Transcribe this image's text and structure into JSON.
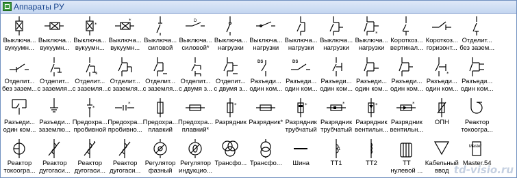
{
  "window": {
    "title": "Аппараты РУ",
    "watermark": "td-visio.ru"
  },
  "stencils": [
    {
      "name": "switch-vacuum",
      "l1": "Выключа...",
      "l2": "вукуумн...",
      "icon": "box-x"
    },
    {
      "name": "switch-vacuum-2",
      "l1": "Выключа...",
      "l2": "вукуумн...",
      "icon": "box-x-h"
    },
    {
      "name": "switch-vacuum-3",
      "l1": "Выключа...",
      "l2": "вукуумн...",
      "icon": "box-x-star"
    },
    {
      "name": "switch-vacuum-4",
      "l1": "Выключа...",
      "l2": "вукуумн...",
      "icon": "box-x-h-star"
    },
    {
      "name": "switch-power",
      "l1": "Выключа...",
      "l2": "силовой",
      "icon": "sw-v"
    },
    {
      "name": "switch-power-2",
      "l1": "Выключа...",
      "l2": "силовой*",
      "icon": "sw-h"
    },
    {
      "name": "switch-load",
      "l1": "Выключа...",
      "l2": "нагрузки",
      "icon": "sw-v2"
    },
    {
      "name": "switch-load-2",
      "l1": "Выключа...",
      "l2": "нагрузки",
      "icon": "sw-h2"
    },
    {
      "name": "switch-load-3",
      "l1": "Выключа...",
      "l2": "нагрузки",
      "icon": "sw-bracket"
    },
    {
      "name": "switch-load-4",
      "l1": "Выключа...",
      "l2": "нагрузки",
      "icon": "sw-bracket2"
    },
    {
      "name": "switch-load-5",
      "l1": "Выключа...",
      "l2": "нагрузки",
      "icon": "sw-bracket3"
    },
    {
      "name": "shorter-vertical",
      "l1": "Короткоз...",
      "l2": "вертикал...",
      "icon": "sc-v"
    },
    {
      "name": "shorter-horizontal",
      "l1": "Короткоз...",
      "l2": "горизонт...",
      "icon": "sc-h"
    },
    {
      "name": "disconnector",
      "l1": "Отделит...",
      "l2": "без зазем...",
      "icon": "disc-v"
    },
    {
      "name": "disconnector-2",
      "l1": "Отделит...",
      "l2": "без зазем...",
      "icon": "disc-h"
    },
    {
      "name": "disconnector-earth",
      "l1": "Отделит...",
      "l2": "с заземля...",
      "icon": "disc-e1"
    },
    {
      "name": "disconnector-earth-2",
      "l1": "Отделит...",
      "l2": "с заземля...",
      "icon": "disc-e2"
    },
    {
      "name": "disconnector-earth-3",
      "l1": "Отделит...",
      "l2": "с заземля...",
      "icon": "disc-e3"
    },
    {
      "name": "disconnector-earth-4",
      "l1": "Отделит...",
      "l2": "с заземля...",
      "icon": "disc-e4"
    },
    {
      "name": "disconnector-two",
      "l1": "Отделит...",
      "l2": "с двумя з...",
      "icon": "disc-2e"
    },
    {
      "name": "disconnector-two-2",
      "l1": "Отделит...",
      "l2": "с двумя з...",
      "icon": "disc-2e2"
    },
    {
      "name": "isolator-one",
      "l1": "Разъеди...",
      "l2": "один ком...",
      "icon": "iso-ds"
    },
    {
      "name": "isolator-one-2",
      "l1": "Разъеди...",
      "l2": "один ком...",
      "icon": "iso-ds2"
    },
    {
      "name": "isolator-one-3",
      "l1": "Разъеди...",
      "l2": "один ком...",
      "icon": "iso-e1"
    },
    {
      "name": "isolator-one-4",
      "l1": "Разъеди...",
      "l2": "один ком...",
      "icon": "iso-e2"
    },
    {
      "name": "isolator-one-5",
      "l1": "Разъеди...",
      "l2": "один ком...",
      "icon": "iso-e3"
    },
    {
      "name": "isolator-one-6",
      "l1": "Разъеди...",
      "l2": "один ком...",
      "icon": "iso-e4"
    },
    {
      "name": "isolator-one-7",
      "l1": "Разъеди...",
      "l2": "один ком...",
      "icon": "iso-e5"
    },
    {
      "name": "isolator-one-8",
      "l1": "Разъеди...",
      "l2": "один ком...",
      "icon": "iso-bracket"
    },
    {
      "name": "isolator-earth",
      "l1": "Разъеди...",
      "l2": "заземлю...",
      "icon": "iso-gnd"
    },
    {
      "name": "fuse-breakdown",
      "l1": "Предохра...",
      "l2": "пробивной",
      "icon": "fuse-pb"
    },
    {
      "name": "fuse-breakdown-2",
      "l1": "Предохра...",
      "l2": "пробивно...",
      "icon": "fuse-pb-h"
    },
    {
      "name": "fuse-fusible",
      "l1": "Предохра...",
      "l2": "плавкий",
      "icon": "fuse-v"
    },
    {
      "name": "fuse-fusible-2",
      "l1": "Предохра...",
      "l2": "плавкий*",
      "icon": "fuse-h"
    },
    {
      "name": "arrester",
      "l1": "Разрядник",
      "l2": "",
      "icon": "arr-v"
    },
    {
      "name": "arrester-2",
      "l1": "Разрядник*",
      "l2": "",
      "icon": "arr-h"
    },
    {
      "name": "arrester-tube",
      "l1": "Разрядник",
      "l2": "трубчатый",
      "icon": "arr-tube"
    },
    {
      "name": "arrester-tube-2",
      "l1": "Разрядник",
      "l2": "трубчатый",
      "icon": "arr-tube-h"
    },
    {
      "name": "arrester-valve",
      "l1": "Разрядник",
      "l2": "вентильн...",
      "icon": "arr-valve"
    },
    {
      "name": "arrester-valve-2",
      "l1": "Разрядник",
      "l2": "вентильн...",
      "icon": "arr-valve-h"
    },
    {
      "name": "opn",
      "l1": "ОПН",
      "l2": "",
      "icon": "opn"
    },
    {
      "name": "reactor-current",
      "l1": "Реактор",
      "l2": "токоогра...",
      "icon": "reactor"
    },
    {
      "name": "reactor-current-2",
      "l1": "Реактор",
      "l2": "токоогра...",
      "icon": "reactor2"
    },
    {
      "name": "reactor-arc",
      "l1": "Реактор",
      "l2": "дугогаси...",
      "icon": "arc1"
    },
    {
      "name": "reactor-arc-2",
      "l1": "Реактор",
      "l2": "дугогаси...",
      "icon": "arc2"
    },
    {
      "name": "reactor-arc-3",
      "l1": "Реактор",
      "l2": "дугогаси...",
      "icon": "arc3"
    },
    {
      "name": "regulator-phase",
      "l1": "Регулятор",
      "l2": "фазный",
      "icon": "reg1"
    },
    {
      "name": "regulator-ind",
      "l1": "Регулятор",
      "l2": "индукцио...",
      "icon": "reg2"
    },
    {
      "name": "transformer",
      "l1": "Трансфо...",
      "l2": "",
      "icon": "trans3"
    },
    {
      "name": "transformer-2",
      "l1": "Трансфо...",
      "l2": "",
      "icon": "trans2"
    },
    {
      "name": "bus",
      "l1": "Шина",
      "l2": "",
      "icon": "bus"
    },
    {
      "name": "ct1",
      "l1": "ТТ1",
      "l2": "",
      "icon": "ct1"
    },
    {
      "name": "ct2",
      "l1": "ТТ2",
      "l2": "",
      "icon": "ct2"
    },
    {
      "name": "ct-zero",
      "l1": "ТТ",
      "l2": "нулевой ...",
      "icon": "ct0"
    },
    {
      "name": "cable-input",
      "l1": "Кабельный",
      "l2": "ввод",
      "icon": "cable"
    },
    {
      "name": "master54",
      "l1": "Master.54",
      "l2": "",
      "icon": "master"
    }
  ]
}
